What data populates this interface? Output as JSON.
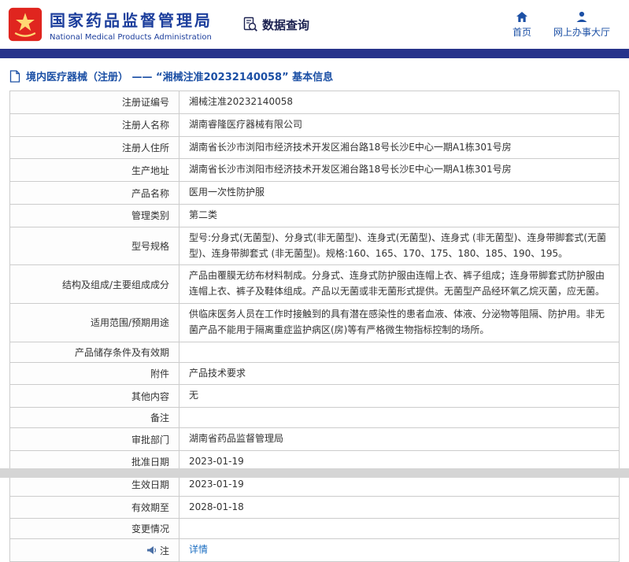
{
  "header": {
    "org_cn": "国家药品监督管理局",
    "org_en": "National Medical Products Administration",
    "nav_query": "数据查询",
    "nav_home": "首页",
    "nav_hall": "网上办事大厅"
  },
  "breadcrumb": {
    "title": "境内医疗器械（注册） ——  “湘械注准20232140058”  基本信息"
  },
  "colors": {
    "accent_blue": "#1c50a5",
    "bar_blue": "#27338b",
    "link_blue": "#1b6ec2",
    "emblem_red": "#e0251f",
    "emblem_gold": "#ffd873"
  },
  "icons": {
    "emblem": "national-emblem",
    "query": "document-magnifier",
    "home": "house",
    "hall": "person",
    "breadcrumb": "document",
    "note": "megaphone"
  },
  "table": {
    "rows": [
      {
        "label": "注册证编号",
        "value": "湘械注准20232140058"
      },
      {
        "label": "注册人名称",
        "value": "湖南睿隆医疗器械有限公司"
      },
      {
        "label": "注册人住所",
        "value": "湖南省长沙市浏阳市经济技术开发区湘台路18号长沙E中心一期A1栋301号房"
      },
      {
        "label": "生产地址",
        "value": "湖南省长沙市浏阳市经济技术开发区湘台路18号长沙E中心一期A1栋301号房"
      },
      {
        "label": "产品名称",
        "value": "医用一次性防护服"
      },
      {
        "label": "管理类别",
        "value": "第二类"
      },
      {
        "label": "型号规格",
        "value": "型号:分身式(无菌型)、分身式(非无菌型)、连身式(无菌型)、连身式 (非无菌型)、连身带脚套式(无菌型)、连身带脚套式 (非无菌型)。规格:160、165、170、175、180、185、190、195。"
      },
      {
        "label": "结构及组成/主要组成成分",
        "value": "产品由覆膜无纺布材料制成。分身式、连身式防护服由连帽上衣、裤子组成；连身带脚套式防护服由连帽上衣、裤子及鞋体组成。产品以无菌或非无菌形式提供。无菌型产品经环氧乙烷灭菌，应无菌。"
      },
      {
        "label": "适用范围/预期用途",
        "value": "供临床医务人员在工作时接触到的具有潜在感染性的患者血液、体液、分泌物等阻隔、防护用。非无菌产品不能用于隔离重症监护病区(房)等有严格微生物指标控制的场所。"
      },
      {
        "label": "产品储存条件及有效期",
        "value": ""
      },
      {
        "label": "附件",
        "value": "产品技术要求"
      },
      {
        "label": "其他内容",
        "value": "无"
      },
      {
        "label": "备注",
        "value": ""
      },
      {
        "label": "审批部门",
        "value": "湖南省药品监督管理局"
      },
      {
        "label": "批准日期",
        "value": "2023-01-19"
      },
      {
        "label": "生效日期",
        "value": "2023-01-19"
      },
      {
        "label": "有效期至",
        "value": "2028-01-18"
      },
      {
        "label": "变更情况",
        "value": ""
      },
      {
        "label": "注",
        "value": "详情"
      }
    ]
  }
}
